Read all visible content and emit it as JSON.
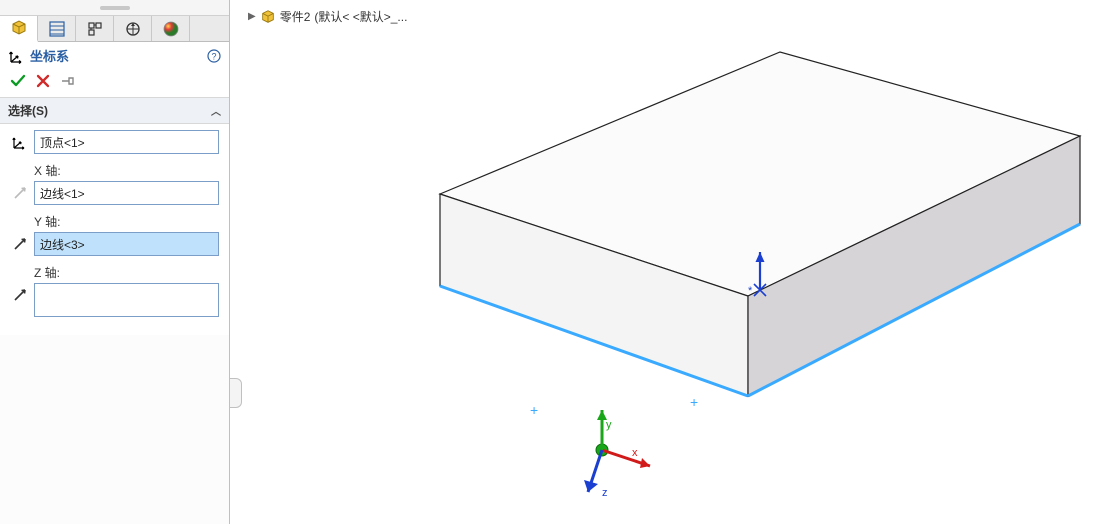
{
  "panel": {
    "title": "坐标系",
    "selection_header": "选择(S)",
    "origin_value": "顶点<1>",
    "x_label": "X 轴:",
    "x_value": "边线<1>",
    "y_label": "Y 轴:",
    "y_value": "边线<3>",
    "z_label": "Z 轴:",
    "z_value": ""
  },
  "breadcrumb": {
    "part": "零件2",
    "state": "(默认< <默认>_..."
  }
}
